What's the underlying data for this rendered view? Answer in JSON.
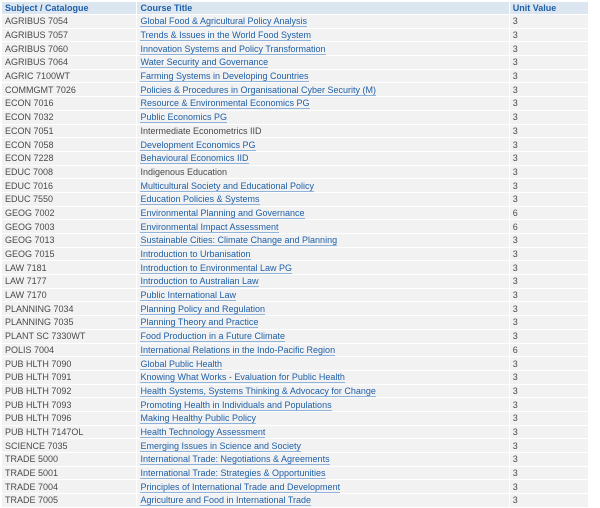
{
  "table": {
    "headers": {
      "subject": "Subject / Catalogue",
      "title": "Course Title",
      "unit": "Unit Value"
    },
    "rows": [
      {
        "subject": "AGRIBUS 7054",
        "title": "Global Food & Agricultural Policy Analysis",
        "unit": "3",
        "link": true
      },
      {
        "subject": "AGRIBUS 7057",
        "title": "Trends & Issues in the World Food System",
        "unit": "3",
        "link": true
      },
      {
        "subject": "AGRIBUS 7060",
        "title": "Innovation Systems and Policy Transformation",
        "unit": "3",
        "link": true
      },
      {
        "subject": "AGRIBUS 7064",
        "title": "Water Security and Governance",
        "unit": "3",
        "link": true
      },
      {
        "subject": "AGRIC 7100WT",
        "title": "Farming Systems in Developing Countries",
        "unit": "3",
        "link": true
      },
      {
        "subject": "COMMGMT 7026",
        "title": "Policies & Procedures in Organisational Cyber Security (M)",
        "unit": "3",
        "link": true
      },
      {
        "subject": "ECON 7016",
        "title": "Resource & Environmental Economics PG",
        "unit": "3",
        "link": true
      },
      {
        "subject": "ECON 7032",
        "title": "Public Economics PG",
        "unit": "3",
        "link": true
      },
      {
        "subject": "ECON 7051",
        "title": "Intermediate Econometrics IID",
        "unit": "3",
        "link": false
      },
      {
        "subject": "ECON 7058",
        "title": "Development Economics PG",
        "unit": "3",
        "link": true
      },
      {
        "subject": "ECON 7228",
        "title": "Behavioural Economics IID",
        "unit": "3",
        "link": true
      },
      {
        "subject": "EDUC 7008",
        "title": "Indigenous Education",
        "unit": "3",
        "link": false
      },
      {
        "subject": "EDUC 7016",
        "title": "Multicultural Society and Educational Policy",
        "unit": "3",
        "link": true
      },
      {
        "subject": "EDUC 7550",
        "title": "Education Policies & Systems",
        "unit": "3",
        "link": true
      },
      {
        "subject": "GEOG 7002",
        "title": "Environmental Planning and Governance",
        "unit": "6",
        "link": true
      },
      {
        "subject": "GEOG 7003",
        "title": "Environmental Impact Assessment",
        "unit": "6",
        "link": true
      },
      {
        "subject": "GEOG 7013",
        "title": "Sustainable Cities: Climate Change and Planning",
        "unit": "3",
        "link": true
      },
      {
        "subject": "GEOG 7015",
        "title": "Introduction to Urbanisation",
        "unit": "3",
        "link": true
      },
      {
        "subject": "LAW 7181",
        "title": "Introduction to Environmental Law PG",
        "unit": "3",
        "link": true
      },
      {
        "subject": "LAW 7177",
        "title": "Introduction to Australian Law",
        "unit": "3",
        "link": true
      },
      {
        "subject": "LAW 7170",
        "title": "Public International Law",
        "unit": "3",
        "link": true
      },
      {
        "subject": "PLANNING 7034",
        "title": "Planning Policy and Regulation",
        "unit": "3",
        "link": true
      },
      {
        "subject": "PLANNING 7035",
        "title": "Planning Theory and Practice",
        "unit": "3",
        "link": true
      },
      {
        "subject": "PLANT SC 7330WT",
        "title": "Food Production in a Future Climate",
        "unit": "3",
        "link": true
      },
      {
        "subject": "POLIS 7004",
        "title": "International Relations in the Indo-Pacific Region",
        "unit": "6",
        "link": true
      },
      {
        "subject": "PUB HLTH 7090",
        "title": "Global Public Health",
        "unit": "3",
        "link": true
      },
      {
        "subject": "PUB HLTH 7091",
        "title": "Knowing What Works - Evaluation for Public Health",
        "unit": "3",
        "link": true
      },
      {
        "subject": "PUB HLTH 7092",
        "title": "Health Systems, Systems Thinking & Advocacy for Change",
        "unit": "3",
        "link": true
      },
      {
        "subject": "PUB HLTH 7093",
        "title": "Promoting Health in Individuals and Populations",
        "unit": "3",
        "link": true
      },
      {
        "subject": "PUB HLTH 7096",
        "title": "Making Healthy Public Policy",
        "unit": "3",
        "link": true
      },
      {
        "subject": "PUB HLTH 7147OL",
        "title": "Health Technology Assessment",
        "unit": "3",
        "link": true
      },
      {
        "subject": "SCIENCE 7035",
        "title": "Emerging Issues in Science and Society",
        "unit": "3",
        "link": true
      },
      {
        "subject": "TRADE 5000",
        "title": "International Trade: Negotiations & Agreements",
        "unit": "3",
        "link": true
      },
      {
        "subject": "TRADE 5001",
        "title": "International Trade: Strategies & Opportunities",
        "unit": "3",
        "link": true
      },
      {
        "subject": "TRADE 7004",
        "title": "Principles of International Trade and Development",
        "unit": "3",
        "link": true
      },
      {
        "subject": "TRADE 7005",
        "title": "Agriculture and Food in International Trade",
        "unit": "3",
        "link": true
      }
    ]
  }
}
